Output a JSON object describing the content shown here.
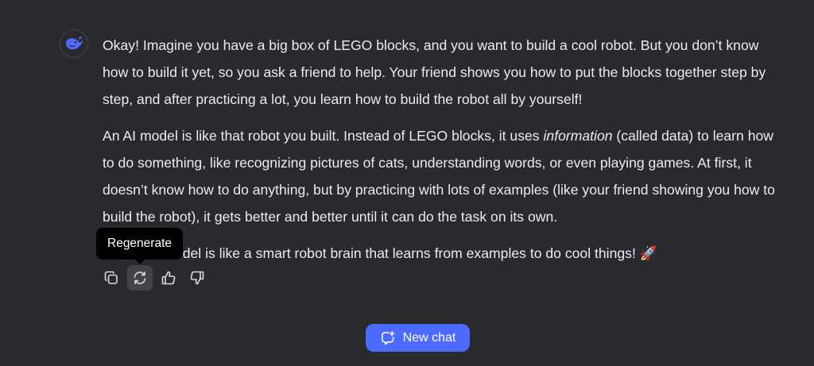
{
  "message": {
    "paragraph_1": "Okay! Imagine you have a big box of LEGO blocks, and you want to build a cool robot. But you don’t know how to build it yet, so you ask a friend to help. Your friend shows you how to put the blocks together step by step, and after practicing a lot, you learn how to build the robot all by yourself!",
    "paragraph_2_before": "An AI model is like that robot you built. Instead of LEGO blocks, it uses ",
    "paragraph_2_emphasis": "information",
    "paragraph_2_after": " (called data) to learn how to do something, like recognizing pictures of cats, understanding words, or even playing games. At first, it doesn’t know how to do anything, but by practicing with lots of examples (like your friend showing you how to build the robot), it gets better and better until it can do the task on its own.",
    "paragraph_3": "So, an AI model is like a smart robot brain that learns from examples to do cool things! 🚀"
  },
  "actions": {
    "icons": [
      "copy-icon",
      "regenerate-icon",
      "thumbs-up-icon",
      "thumbs-down-icon"
    ],
    "active": "regenerate"
  },
  "tooltip": {
    "text": "Regenerate"
  },
  "new_chat": {
    "label": "New chat",
    "color": "#4d6bfe"
  },
  "colors": {
    "background": "#292a2d",
    "text": "#ececf0",
    "accent": "#4d6bfe"
  }
}
